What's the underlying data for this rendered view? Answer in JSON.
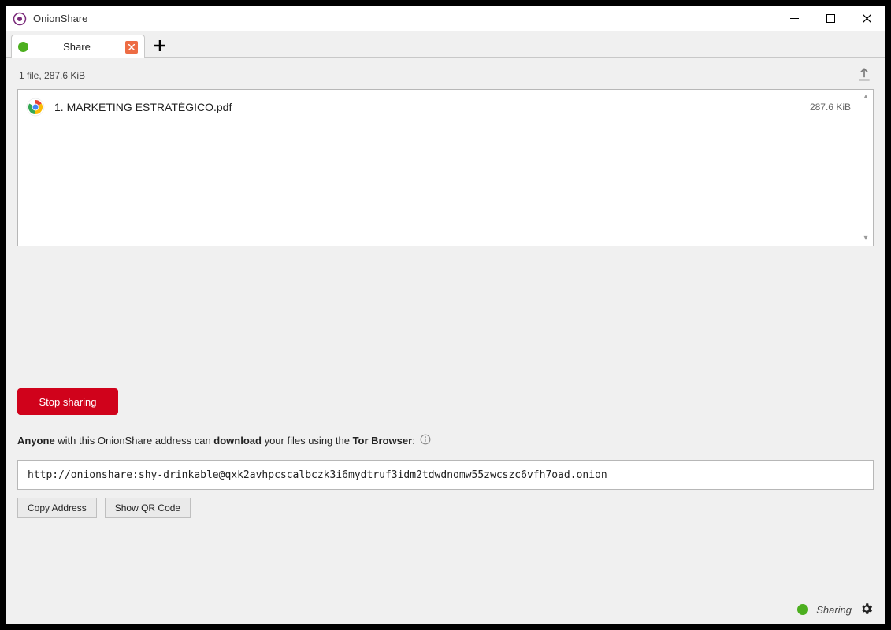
{
  "window": {
    "title": "OnionShare"
  },
  "tabs": [
    {
      "label": "Share"
    }
  ],
  "files": {
    "summary": "1 file, 287.6 KiB",
    "items": [
      {
        "name": "1. MARKETING ESTRATÉGICO.pdf",
        "size": "287.6 KiB"
      }
    ]
  },
  "actions": {
    "stop_sharing": "Stop sharing",
    "copy_address": "Copy Address",
    "show_qr": "Show QR Code"
  },
  "info": {
    "segments": {
      "s1": "Anyone",
      "s2": " with this OnionShare address can ",
      "s3": "download",
      "s4": " your files using the ",
      "s5": "Tor Browser",
      "s6": ":"
    }
  },
  "address": "http://onionshare:shy-drinkable@qxk2avhpcscalbczk3i6mydtruf3idm2tdwdnomw55zwcszc6vfh7oad.onion",
  "status": {
    "label": "Sharing"
  }
}
